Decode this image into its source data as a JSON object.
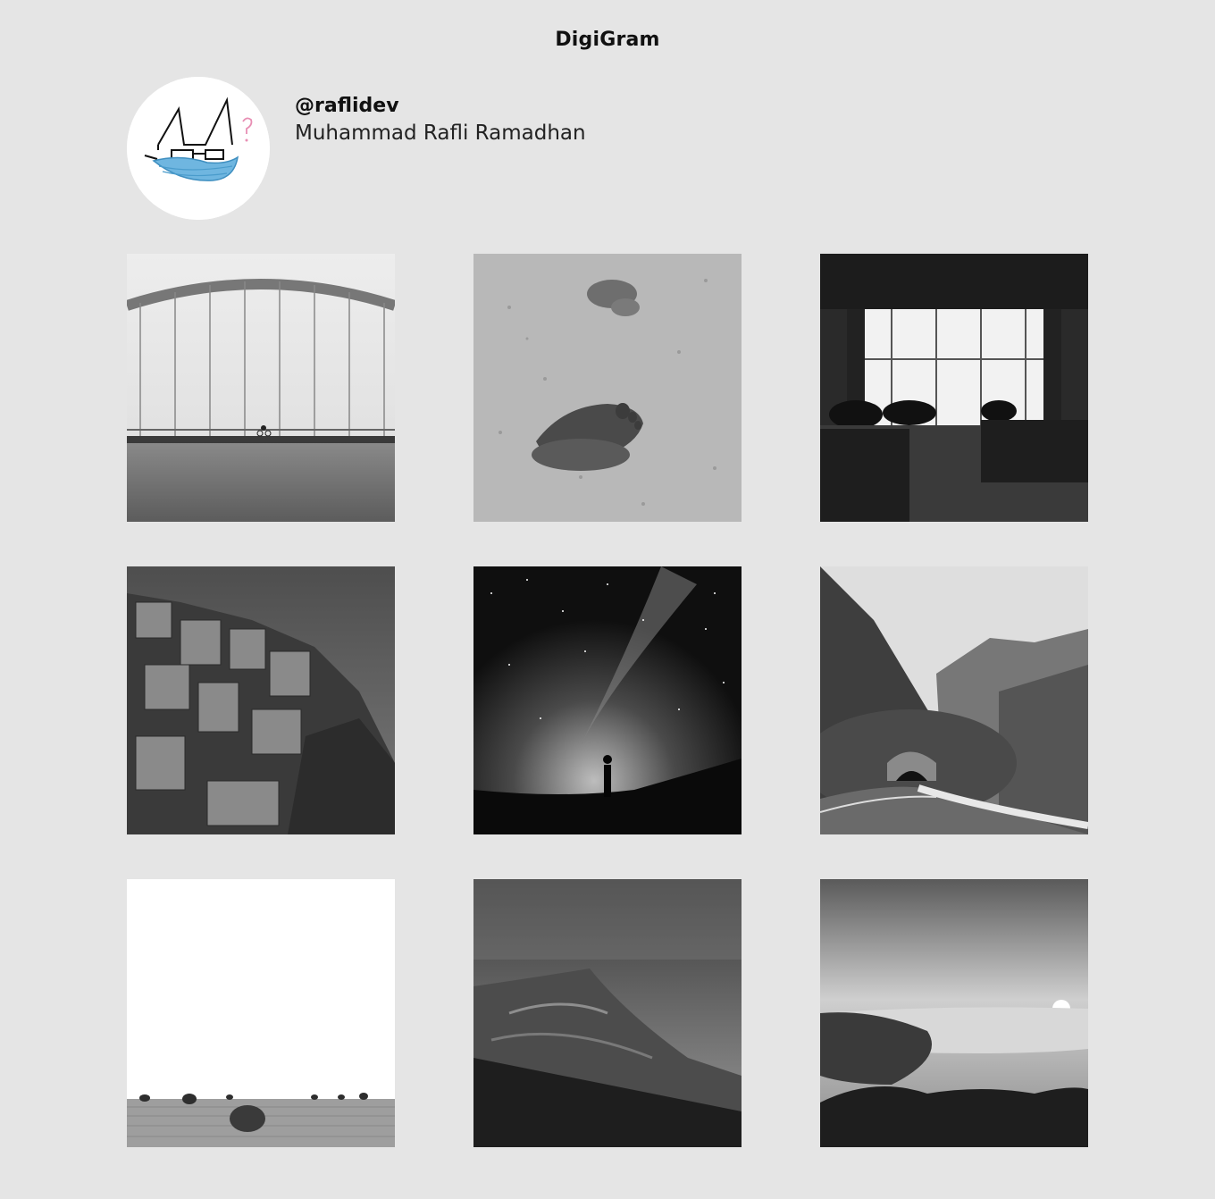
{
  "app": {
    "title": "DigiGram"
  },
  "profile": {
    "username": "@raflidev",
    "full_name": "Muhammad Rafli Ramadhan",
    "avatar_icon": "cat-with-mask-drawing"
  },
  "posts": [
    {
      "subject": "bridge-over-sea"
    },
    {
      "subject": "footprints-in-sand"
    },
    {
      "subject": "cafe-interior"
    },
    {
      "subject": "cliffside-village"
    },
    {
      "subject": "milky-way-silhouette"
    },
    {
      "subject": "mountain-road-tunnel"
    },
    {
      "subject": "hay-bales-field"
    },
    {
      "subject": "foggy-mountain"
    },
    {
      "subject": "sunrise-over-clouds"
    }
  ],
  "colors": {
    "background": "#e5e5e5",
    "mask_blue": "#6fb6e0",
    "accent_pink": "#e88fb4"
  }
}
